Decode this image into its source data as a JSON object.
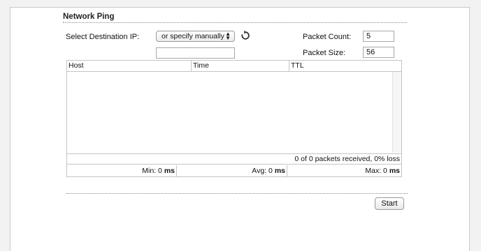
{
  "section": {
    "title": "Network Ping"
  },
  "form": {
    "dest_label": "Select Destination IP:",
    "dest_select_value": "or specify manually",
    "dest_manual_value": "",
    "packet_count_label": "Packet Count:",
    "packet_count_value": "5",
    "packet_size_label": "Packet Size:",
    "packet_size_value": "56"
  },
  "table": {
    "columns": [
      "Host",
      "Time",
      "TTL"
    ],
    "rows": [],
    "status": "0 of 0 packets received, 0% loss",
    "min_label": "Min:",
    "min_value": "0",
    "avg_label": "Avg:",
    "avg_value": "0",
    "max_label": "Max:",
    "max_value": "0",
    "unit": "ms"
  },
  "actions": {
    "start_label": "Start"
  },
  "icons": {
    "refresh": "refresh-icon",
    "select_arrows": "select-arrows-icon"
  }
}
